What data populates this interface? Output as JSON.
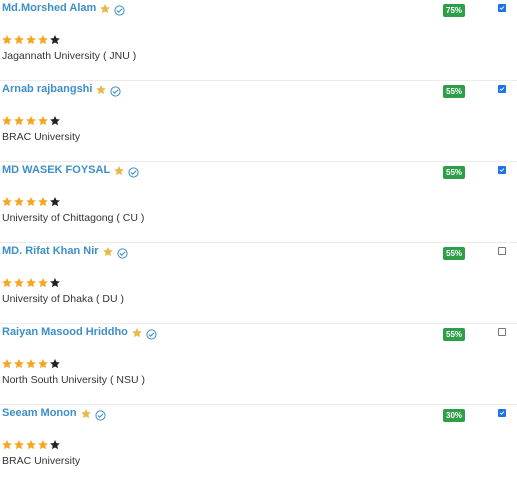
{
  "colors": {
    "name": "#3d8fc7",
    "star_filled": "#f5a623",
    "star_empty": "#222222",
    "badge_star": "#e8b84a",
    "verified": "#3d8fc7",
    "percent_bg": "#2e9e49",
    "checkbox_on": "#1a73e8"
  },
  "icons": {
    "badge": "star-icon",
    "verified": "verified-icon",
    "rating": "rating-star-icon"
  },
  "rows": [
    {
      "name": "Md.Morshed Alam",
      "university": "Jagannath University ( JNU )",
      "percent": "75%",
      "rating": 4,
      "rating_max": 5,
      "checked": true
    },
    {
      "name": "Arnab rajbangshi",
      "university": "BRAC University",
      "percent": "55%",
      "rating": 4,
      "rating_max": 5,
      "checked": true
    },
    {
      "name": "MD WASEK FOYSAL",
      "university": "University of Chittagong ( CU )",
      "percent": "55%",
      "rating": 4,
      "rating_max": 5,
      "checked": true
    },
    {
      "name": "MD. Rifat Khan Nir",
      "university": "University of Dhaka ( DU )",
      "percent": "55%",
      "rating": 4,
      "rating_max": 5,
      "checked": false
    },
    {
      "name": "Raiyan Masood Hriddho",
      "university": "North South University ( NSU )",
      "percent": "55%",
      "rating": 4,
      "rating_max": 5,
      "checked": false
    },
    {
      "name": "Seeam Monon",
      "university": "BRAC University",
      "percent": "30%",
      "rating": 4,
      "rating_max": 5,
      "checked": true
    }
  ]
}
